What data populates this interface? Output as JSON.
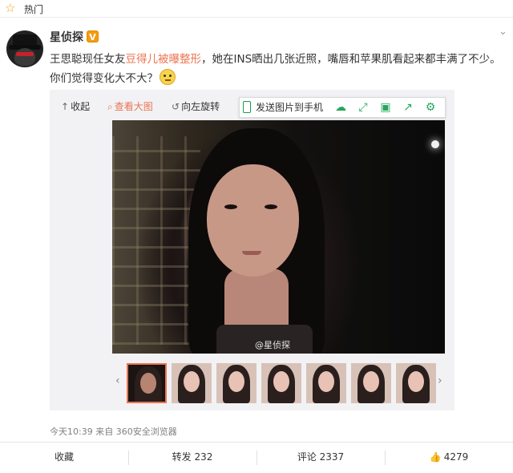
{
  "header": {
    "section_label": "热门"
  },
  "post": {
    "author": "星侦探",
    "verified_badge": "V",
    "text_before_link": "王思聪现任女友",
    "text_link": "豆得儿被曝整形",
    "text_after_link": "，她在INS晒出几张近照，嘴唇和苹果肌看起来都丰满了不少。",
    "text_line2": "你们觉得变化大不大？",
    "timestamp": "今天10:39",
    "source_prefix": "来自",
    "source": "360安全浏览器"
  },
  "media_toolbar": {
    "collapse": "收起",
    "view_large": "查看大图",
    "rotate_left": "向左旋转",
    "send_to_phone": "发送图片到手机"
  },
  "image": {
    "watermark": "@星侦探",
    "thumbnail_count": 7,
    "selected_thumbnail": 1
  },
  "actions": {
    "favorite": "收藏",
    "repost": "转发 232",
    "comment": "评论 2337",
    "like": "4279"
  },
  "colors": {
    "link": "#eb7350",
    "accent_green": "#26a65b",
    "star": "#f3a21c"
  }
}
